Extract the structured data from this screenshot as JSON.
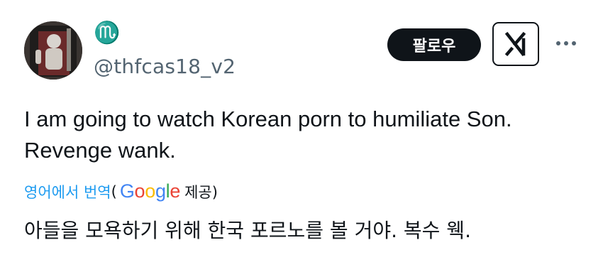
{
  "author": {
    "display_name": "♏",
    "handle": "@thfcas18_v2"
  },
  "header": {
    "follow_label": "팔로우",
    "grok_icon": "grok-icon",
    "more_icon": "more-icon"
  },
  "tweet": {
    "line_1": "I am going to watch Korean porn to humiliate Son.",
    "line_2": "Revenge wank."
  },
  "translation": {
    "link_label": "영어에서 번역",
    "open_paren": "(",
    "provider_g1": "G",
    "provider_o1": "o",
    "provider_o2": "o",
    "provider_g2": "g",
    "provider_l": "l",
    "provider_e": "e",
    "provided_label": "제공)",
    "text": "아들을 모욕하기 위해 한국 포르노를 볼 거야. 복수 웩."
  },
  "colors": {
    "text": "#0f1419",
    "secondary": "#536471",
    "link": "#1d9bf0",
    "button_bg": "#0f1419"
  }
}
